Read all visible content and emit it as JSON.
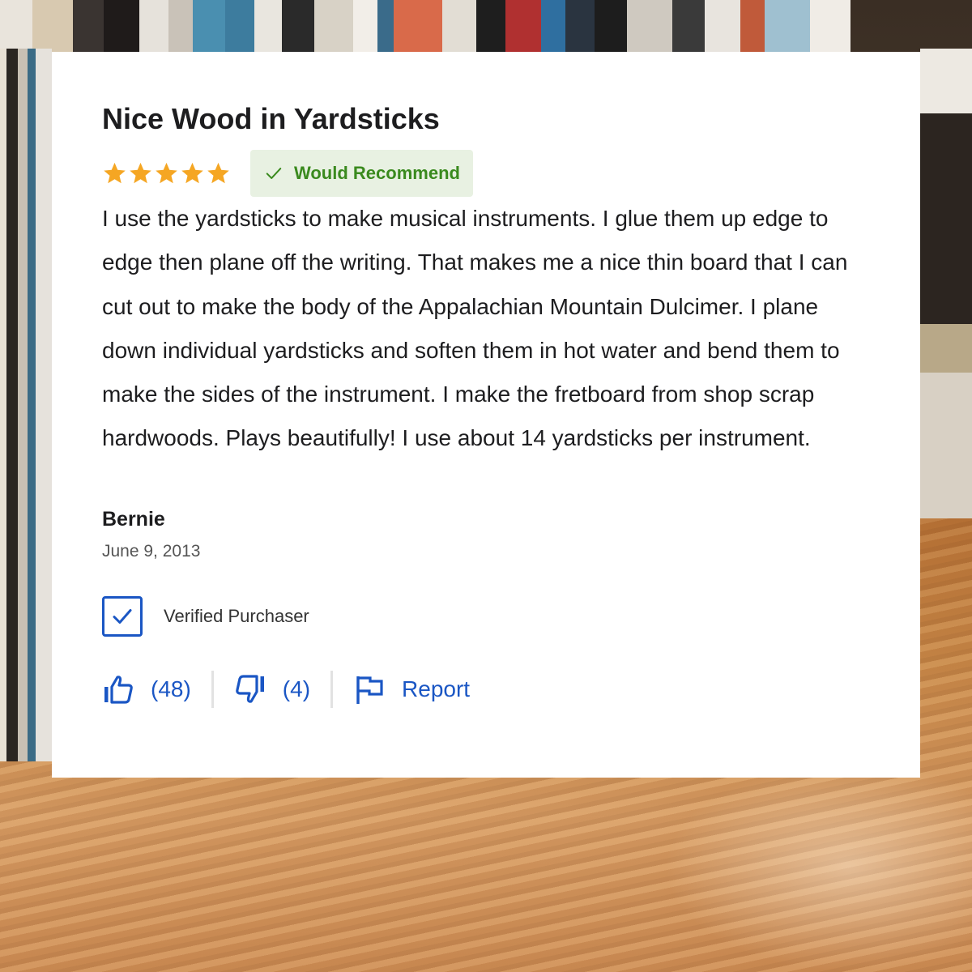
{
  "review": {
    "title": "Nice Wood in Yardsticks",
    "rating": 5,
    "rating_max": 5,
    "recommend_label": "Would Recommend",
    "body": "I use the yardsticks to make musical instruments. I glue them up edge to edge then plane off the writing. That makes me a nice thin board that I can cut out to make the body of the Appalachian Mountain Dulcimer. I plane down individual yardsticks and soften them in hot water and bend them to make the sides of the instrument. I make the fretboard from shop scrap hardwoods. Plays beautifully! I use about 14 yardsticks per instrument.",
    "author": "Bernie",
    "date": "June 9, 2013",
    "verified_label": "Verified Purchaser",
    "helpful_count": "(48)",
    "unhelpful_count": "(4)",
    "report_label": "Report"
  },
  "icons": {
    "star": "star-icon",
    "recommend": "check-icon",
    "verified": "checkbox-checked-icon",
    "helpful": "thumbs-up-icon",
    "unhelpful": "thumbs-down-icon",
    "report": "flag-icon"
  },
  "colors": {
    "star": "#f5a623",
    "recommend_text": "#3a8a1e",
    "recommend_bg": "#e8f1e2",
    "link_blue": "#1a56c4",
    "text": "#1d1d1f",
    "muted": "#555555"
  }
}
